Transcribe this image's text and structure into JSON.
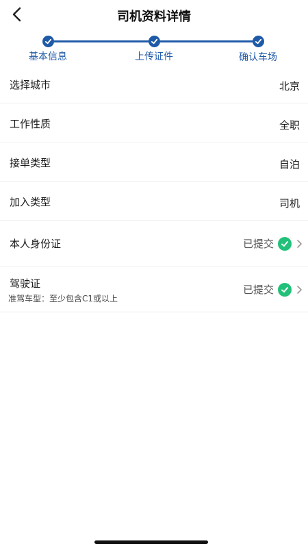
{
  "header": {
    "title": "司机资料详情",
    "back_icon": "chevron-left-icon"
  },
  "stepper": {
    "accent_color": "#1f5aa8",
    "steps": [
      {
        "label": "基本信息",
        "done": true
      },
      {
        "label": "上传证件",
        "done": true
      },
      {
        "label": "确认车场",
        "done": true
      }
    ]
  },
  "rows": {
    "city": {
      "label": "选择城市",
      "value": "北京"
    },
    "work_type": {
      "label": "工作性质",
      "value": "全职"
    },
    "order_type": {
      "label": "接单类型",
      "value": "自泊"
    },
    "join_type": {
      "label": "加入类型",
      "value": "司机"
    },
    "id_card": {
      "label": "本人身份证",
      "status": "已提交"
    },
    "license": {
      "label": "驾驶证",
      "sub": "准驾车型：至少包含C1或以上",
      "status": "已提交"
    }
  },
  "status_color": "#23c07a"
}
